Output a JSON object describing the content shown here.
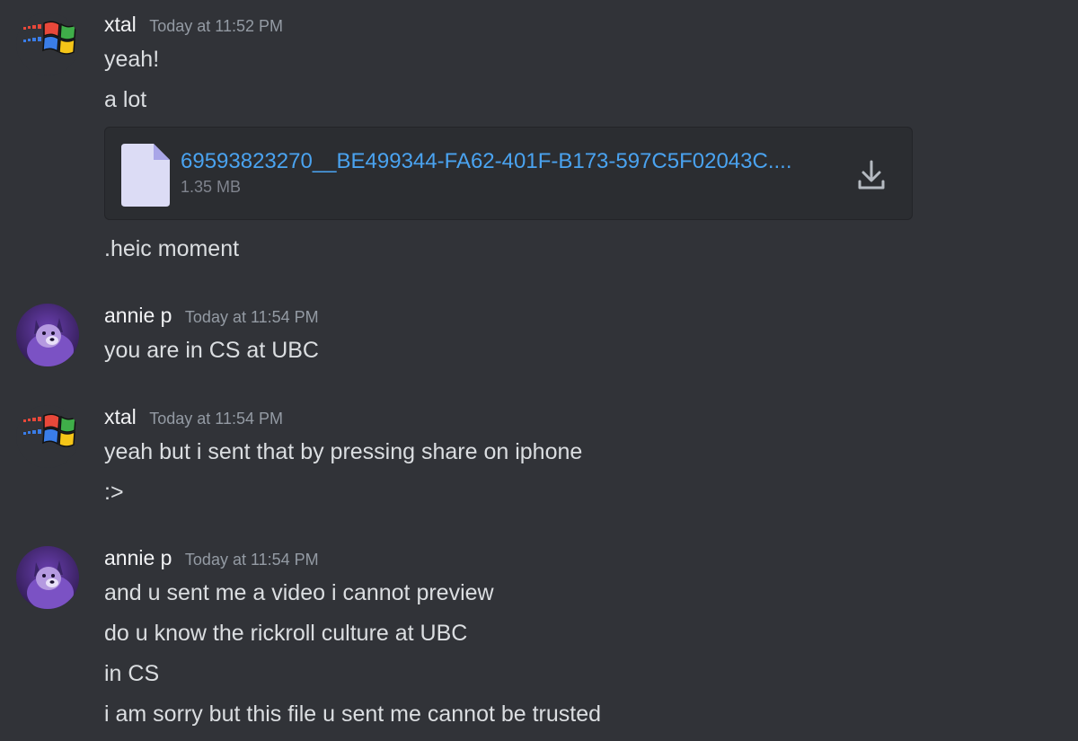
{
  "messages": [
    {
      "username": "xtal",
      "timestamp": "Today at 11:52 PM",
      "avatar": "windows-logo-icon",
      "lines": [
        "yeah!",
        "a lot"
      ],
      "attachment": {
        "file_name": "69593823270__BE499344-FA62-401F-B173-597C5F02043C....",
        "file_size": "1.35 MB",
        "icon": "file-icon",
        "action_icon": "download-icon"
      },
      "after_lines": [
        ".heic moment"
      ]
    },
    {
      "username": "annie p",
      "timestamp": "Today at 11:54 PM",
      "avatar": "dog-photo-avatar",
      "lines": [
        "you are in CS at UBC"
      ]
    },
    {
      "username": "xtal",
      "timestamp": "Today at 11:54 PM",
      "avatar": "windows-logo-icon",
      "lines": [
        "yeah but i sent that by pressing share on iphone",
        ":>"
      ]
    },
    {
      "username": "annie p",
      "timestamp": "Today at 11:54 PM",
      "avatar": "dog-photo-avatar",
      "lines": [
        "and u sent me a video i cannot preview",
        "do u know the rickroll culture at UBC",
        "in CS",
        "i am sorry but this file u sent me cannot be trusted"
      ]
    }
  ],
  "colors": {
    "background": "#313338",
    "link": "#4aa3f0",
    "username": "#f2f3f5",
    "timestamp": "#949ba4",
    "text": "#dbdee1"
  }
}
